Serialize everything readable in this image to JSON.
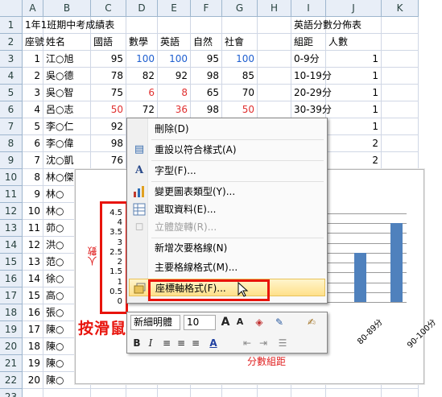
{
  "columns": [
    "A",
    "B",
    "C",
    "D",
    "E",
    "F",
    "G",
    "H",
    "I",
    "J",
    "K"
  ],
  "rows": [
    "1",
    "2",
    "3",
    "4",
    "5",
    "6",
    "7",
    "8",
    "9",
    "10",
    "11",
    "12",
    "13",
    "14",
    "15",
    "16",
    "17",
    "18",
    "19",
    "20",
    "21",
    "22",
    "23"
  ],
  "sheet": {
    "title": "1年1班期中考成績表",
    "title2": "英語分數分佈表",
    "headers": [
      "座號",
      "姓名",
      "國語",
      "數學",
      "英語",
      "自然",
      "社會"
    ],
    "dist_headers": [
      "組距",
      "人數"
    ],
    "students": [
      {
        "no": "1",
        "name": "江○旭",
        "c": "95",
        "m": "100",
        "e": "100",
        "s": "95",
        "so": "100"
      },
      {
        "no": "2",
        "name": "吳○德",
        "c": "78",
        "m": "82",
        "e": "92",
        "s": "98",
        "so": "85"
      },
      {
        "no": "3",
        "name": "吳○智",
        "c": "75",
        "m": "6",
        "e": "8",
        "s": "65",
        "so": "70"
      },
      {
        "no": "4",
        "name": "呂○志",
        "c": "50",
        "m": "72",
        "e": "36",
        "s": "98",
        "so": "50"
      },
      {
        "no": "5",
        "name": "李○仁",
        "c": "92"
      },
      {
        "no": "6",
        "name": "李○偉",
        "c": "98"
      },
      {
        "no": "7",
        "name": "沈○凱",
        "c": "76"
      },
      {
        "no": "8",
        "name": "林○傑"
      },
      {
        "no": "9",
        "name": "林○"
      },
      {
        "no": "10",
        "name": "林○"
      },
      {
        "no": "11",
        "name": "茆○"
      },
      {
        "no": "12",
        "name": "洪○"
      },
      {
        "no": "13",
        "name": "范○"
      },
      {
        "no": "14",
        "name": "徐○"
      },
      {
        "no": "15",
        "name": "高○"
      },
      {
        "no": "16",
        "name": "張○"
      },
      {
        "no": "17",
        "name": "陳○"
      },
      {
        "no": "18",
        "name": "陳○"
      },
      {
        "no": "19",
        "name": "陳○"
      },
      {
        "no": "20",
        "name": "陳○"
      }
    ],
    "dist": [
      {
        "range": "0-9分",
        "count": "1"
      },
      {
        "range": "10-19分",
        "count": "1"
      },
      {
        "range": "20-29分",
        "count": "1"
      },
      {
        "range": "30-39分",
        "count": "1"
      },
      {
        "range": "",
        "count": "1"
      },
      {
        "range": "",
        "count": "2"
      },
      {
        "range": "",
        "count": "2"
      }
    ]
  },
  "chart_data": {
    "type": "bar",
    "ylabel": "人數",
    "xlabel": "分數組距",
    "ylim": [
      0,
      4.5
    ],
    "yticks": [
      "4.5",
      "4",
      "3.5",
      "3",
      "2.5",
      "2",
      "1.5",
      "1",
      "0.5",
      "0"
    ],
    "categories": [
      "80-89分",
      "90-100分"
    ],
    "values": [
      4,
      4,
      4,
      4,
      4,
      2.5,
      4
    ],
    "bar_color": "#4f81bd"
  },
  "annotation": "按滑鼠右鍵",
  "context_menu": {
    "items": [
      {
        "label": "刪除(D)",
        "icon": "delete-icon",
        "disabled": false
      },
      {
        "label": "重設以符合樣式(A)",
        "icon": "reset-style-icon",
        "disabled": false
      },
      {
        "label": "字型(F)...",
        "icon": "font-icon",
        "disabled": false
      },
      {
        "label": "變更圖表類型(Y)...",
        "icon": "chart-type-icon",
        "disabled": false
      },
      {
        "label": "選取資料(E)...",
        "icon": "select-data-icon",
        "disabled": false
      },
      {
        "label": "立體旋轉(R)...",
        "icon": "3d-rotate-icon",
        "disabled": true
      },
      {
        "label": "新增次要格線(N)",
        "icon": "",
        "disabled": false
      },
      {
        "label": "主要格線格式(M)...",
        "icon": "",
        "disabled": false
      },
      {
        "label": "座標軸格式(F)...",
        "icon": "format-axis-icon",
        "disabled": false
      }
    ]
  },
  "mini_toolbar": {
    "font_name": "新細明體",
    "font_size": "10"
  }
}
